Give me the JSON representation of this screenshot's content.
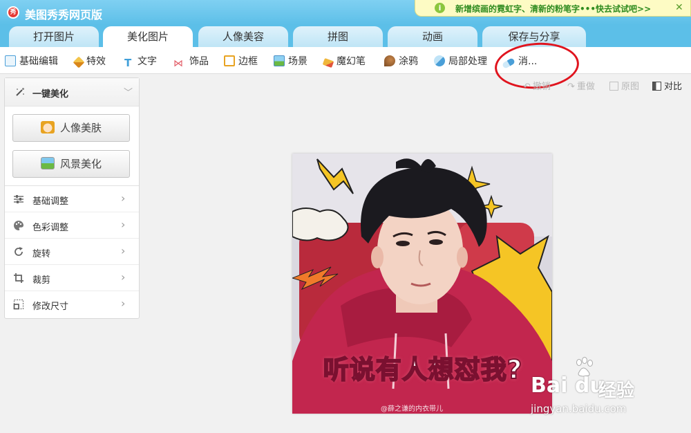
{
  "app": {
    "title": "美图秀秀网页版"
  },
  "notice": {
    "text": "新增缤画的霓虹字、清新的粉笔字•••快去试试吧>>"
  },
  "tabs": [
    {
      "label": "打开图片"
    },
    {
      "label": "美化图片"
    },
    {
      "label": "人像美容"
    },
    {
      "label": "拼图"
    },
    {
      "label": "动画"
    },
    {
      "label": "保存与分享"
    }
  ],
  "toolbar": {
    "items": [
      {
        "label": "基础编辑",
        "icon": "basic-edit-icon",
        "color": "#4a9fd8"
      },
      {
        "label": "特效",
        "icon": "magic-wand-icon",
        "color": "#e8a321"
      },
      {
        "label": "文字",
        "icon": "text-t-icon",
        "color": "#3f9fd9"
      },
      {
        "label": "饰品",
        "icon": "bow-icon",
        "color": "#e25b66"
      },
      {
        "label": "边框",
        "icon": "frame-icon",
        "color": "#e8a321"
      },
      {
        "label": "场景",
        "icon": "scene-icon",
        "color": "#6bb944"
      },
      {
        "label": "魔幻笔",
        "icon": "magic-pen-icon",
        "color": "#f0b73c"
      },
      {
        "label": "涂鸦",
        "icon": "brush-icon",
        "color": "#a86a3c"
      },
      {
        "label": "局部处理",
        "icon": "local-process-icon",
        "color": "#4a9fd8"
      },
      {
        "label": "消...",
        "icon": "eraser-icon",
        "color": "#4a9fd8"
      }
    ]
  },
  "actions": {
    "undo": "撤销",
    "redo": "重做",
    "original": "原图",
    "compare": "对比"
  },
  "panel": {
    "header": "一键美化",
    "buttons": [
      {
        "label": "人像美肤",
        "icon": "portrait-icon"
      },
      {
        "label": "风景美化",
        "icon": "landscape-icon"
      }
    ],
    "items": [
      {
        "label": "基础调整",
        "icon": "sliders-icon"
      },
      {
        "label": "色彩调整",
        "icon": "palette-icon"
      },
      {
        "label": "旋转",
        "icon": "rotate-icon"
      },
      {
        "label": "裁剪",
        "icon": "crop-icon"
      },
      {
        "label": "修改尺寸",
        "icon": "resize-icon"
      }
    ]
  },
  "photo": {
    "caption": "听说有人想怼我?",
    "credit": "@薛之谦的内衣带儿"
  },
  "watermark": {
    "brand": "Bai du",
    "cn": "经验",
    "url": "jingyan.baidu.com"
  },
  "colors": {
    "title_bar": "#5cbfe8",
    "accent_red": "#e0141e",
    "hoodie": "#c2264e",
    "burst_yellow": "#f5c525"
  }
}
